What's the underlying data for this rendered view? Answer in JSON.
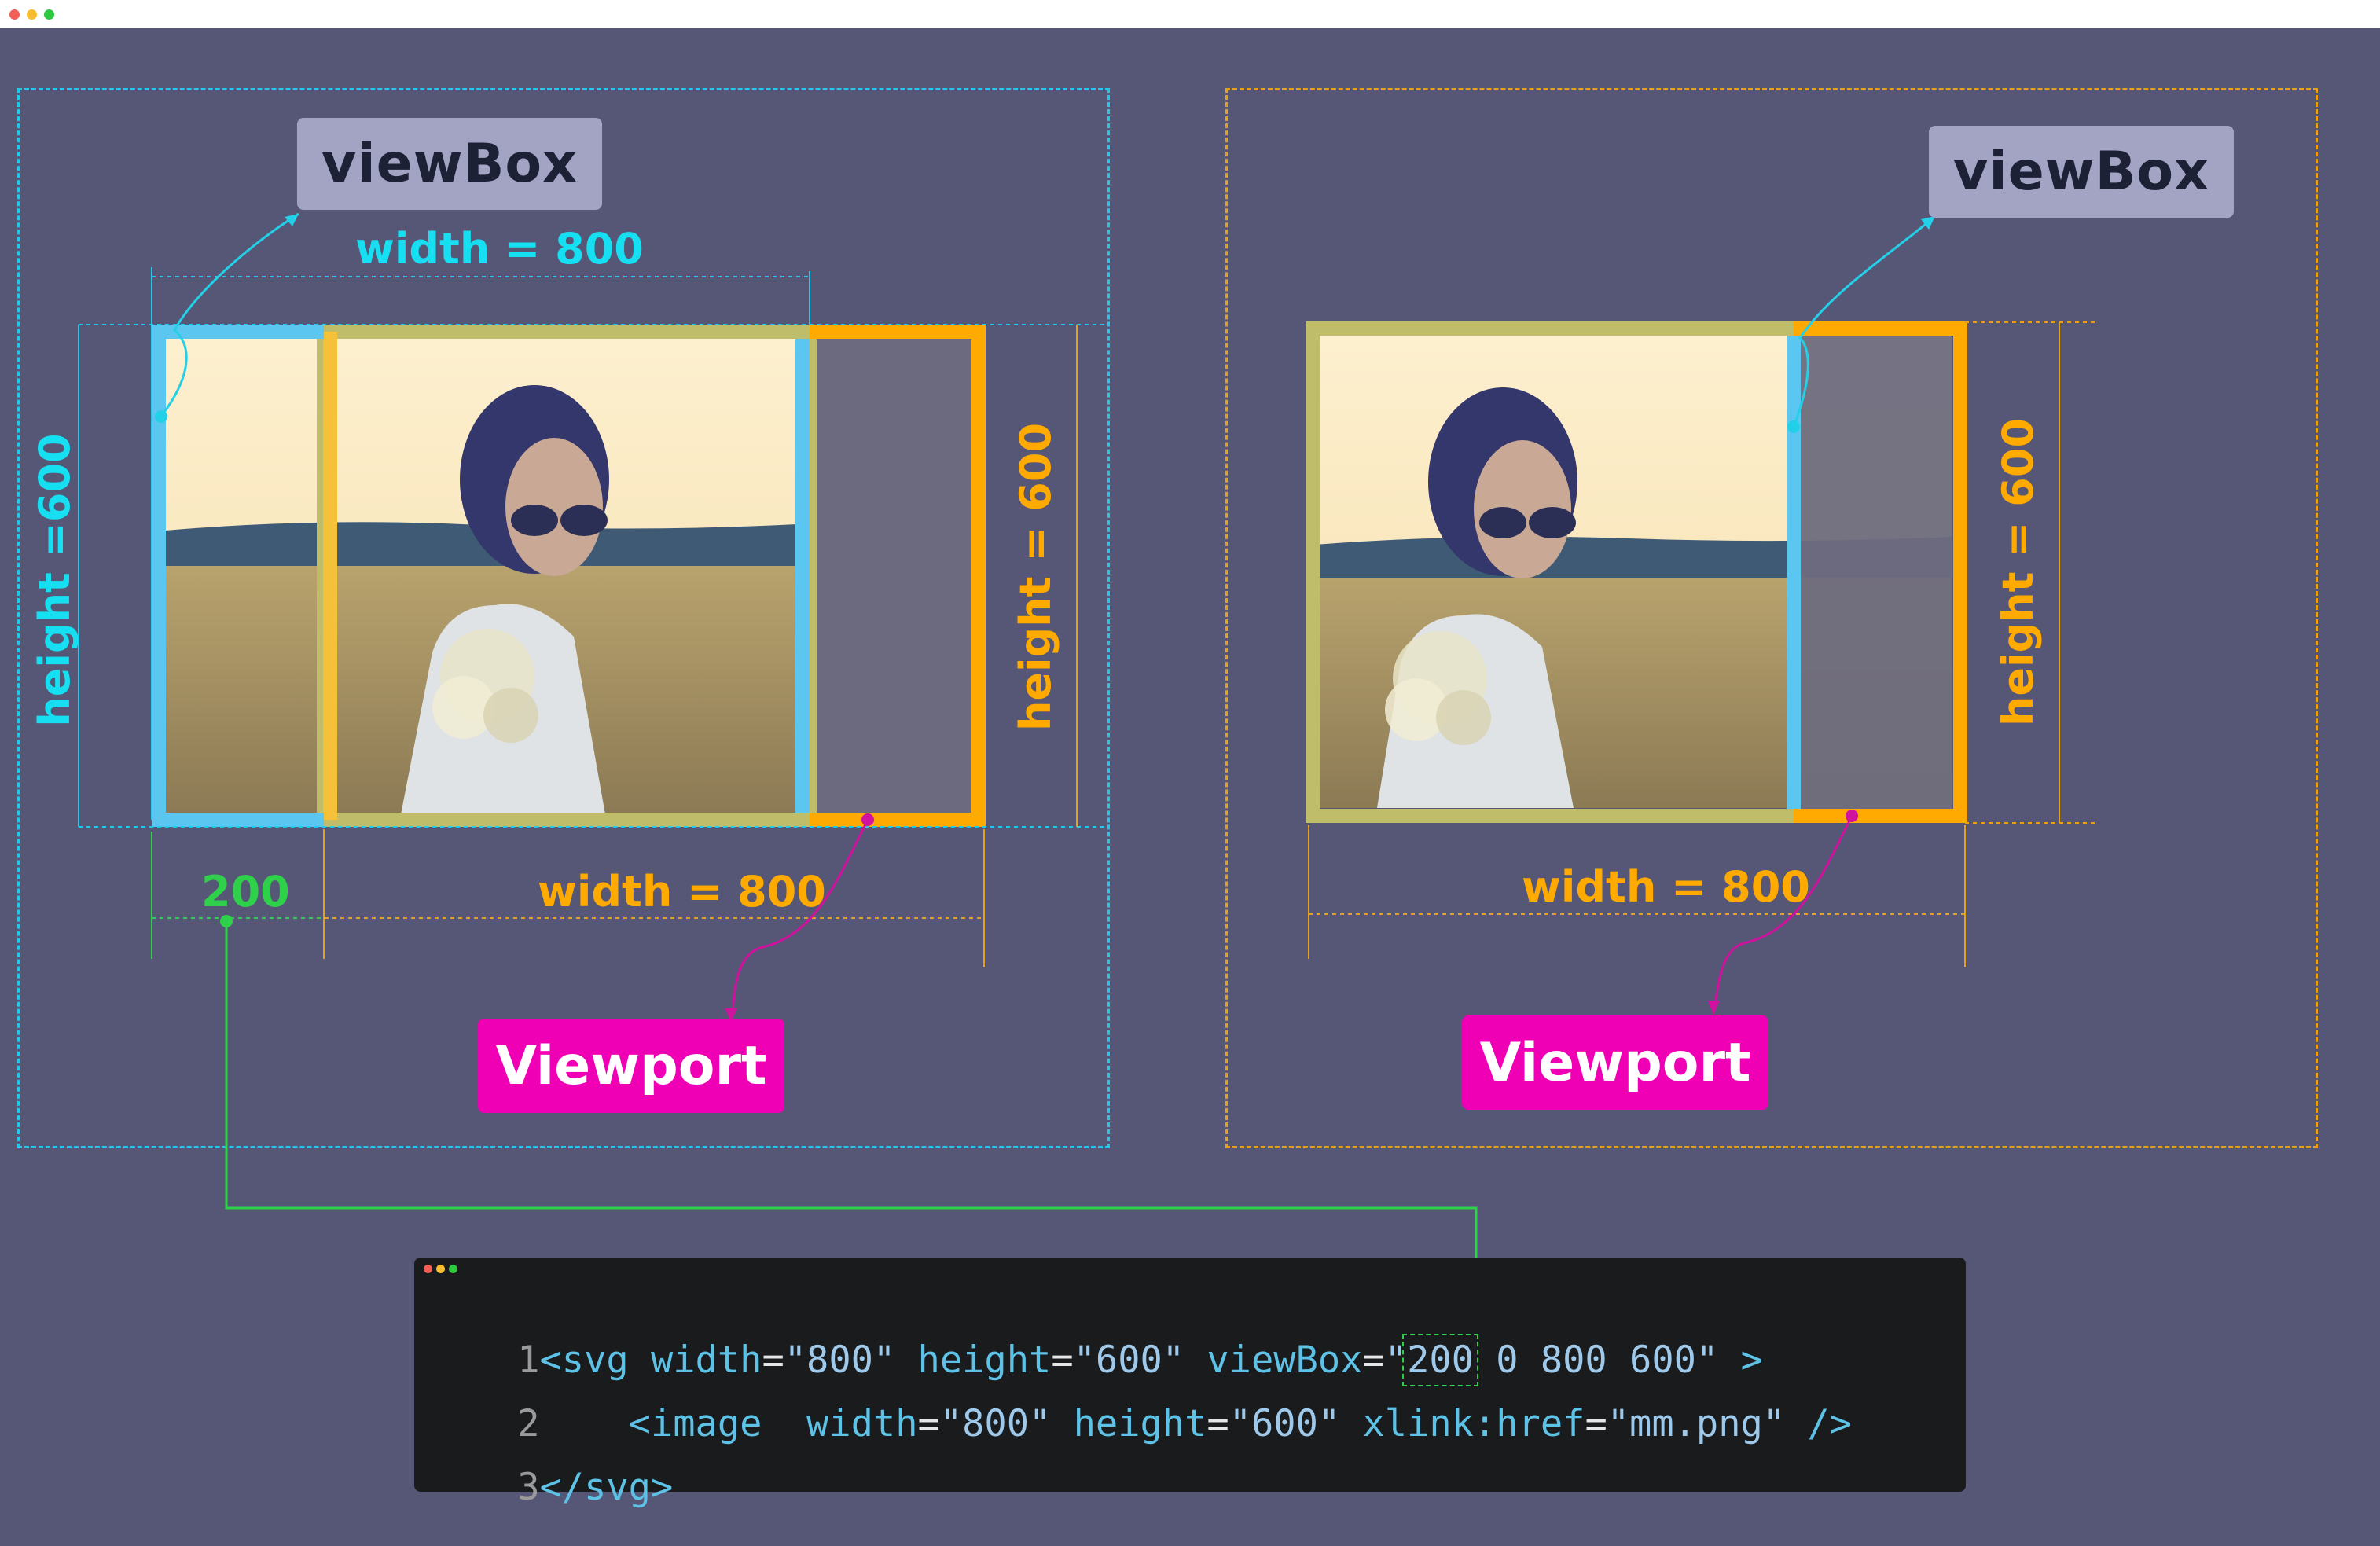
{
  "left_panel": {
    "viewbox_label": "viewBox",
    "viewport_label": "Viewport",
    "viewbox_width_label": "width = 800",
    "viewbox_height_label": "height =600",
    "viewport_height_label": "height = 600",
    "offset_label": "200",
    "viewport_width_label": "width = 800"
  },
  "right_panel": {
    "viewbox_label": "viewBox",
    "viewport_label": "Viewport",
    "viewport_height_label": "height = 600",
    "viewport_width_label": "width = 800"
  },
  "code": {
    "line1": {
      "num": "1",
      "open": "<svg",
      "a1": "width",
      "v1": "\"800\"",
      "a2": "height",
      "v2": "\"600\"",
      "a3": "viewBox",
      "q": "\"",
      "v3hl": "200",
      "v3rest": " 0 800 600\"",
      "close": " >"
    },
    "line2": {
      "num": "2",
      "open": "<image",
      "a1": "width",
      "v1": "\"800\"",
      "a2": "height",
      "v2": "\"600\"",
      "a3": "xlink:href",
      "v3": "\"mm.png\"",
      "close": " />"
    },
    "line3": {
      "num": "3",
      "text": "</svg>"
    }
  },
  "colors": {
    "background": "#565776",
    "viewbox_cyan": "#16dff2",
    "viewport_orange": "#ffaa00",
    "blue_frame": "#5bc6f0",
    "olive_frame": "#c0bd6a",
    "offset_green": "#2fd04a",
    "viewport_pink": "#f000b4",
    "connector_magenta": "#d0129f",
    "code_bg": "#1a1b1d"
  }
}
